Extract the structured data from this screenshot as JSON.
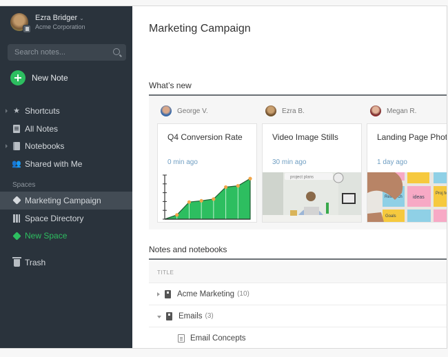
{
  "account": {
    "name": "Ezra Bridger",
    "org": "Acme Corporation",
    "chevron": "⌄"
  },
  "search": {
    "placeholder": "Search notes..."
  },
  "new_note": {
    "label": "New Note"
  },
  "nav": {
    "items": [
      {
        "label": "Shortcuts",
        "icon": "star-icon",
        "expandable": true
      },
      {
        "label": "All Notes",
        "icon": "notes-icon",
        "expandable": false
      },
      {
        "label": "Notebooks",
        "icon": "notebook-icon",
        "expandable": true
      },
      {
        "label": "Shared with Me",
        "icon": "people-icon",
        "expandable": false
      }
    ],
    "spaces_label": "Spaces",
    "spaces": [
      {
        "label": "Marketing Campaign",
        "icon": "cube-icon",
        "selected": true
      },
      {
        "label": "Space Directory",
        "icon": "building-icon",
        "selected": false
      },
      {
        "label": "New Space",
        "icon": "new-space-icon",
        "accent": "#2dbe60"
      }
    ],
    "trash": {
      "label": "Trash",
      "icon": "trash-icon"
    }
  },
  "main": {
    "title": "Marketing Campaign",
    "whats_new": {
      "title": "What’s new",
      "cards": [
        {
          "author": "George V.",
          "title": "Q4 Conversion Rate",
          "time": "0 min ago",
          "thumb": "chart"
        },
        {
          "author": "Ezra B.",
          "title": "Video Image Stills",
          "time": "30 min ago",
          "thumb": "photo",
          "thumb_search_text": "project plans"
        },
        {
          "author": "Megan R.",
          "title": "Landing Page Photos",
          "time": "1 day ago",
          "thumb": "sticky-notes",
          "sticky_labels": [
            "Research",
            "ideas",
            "Goals",
            "Proj Man"
          ]
        }
      ],
      "chart_thumb": {
        "type": "area",
        "values": [
          0,
          1,
          4,
          4.3,
          4.7,
          7.5,
          7.8,
          9.5
        ],
        "color": "#2dbe60",
        "point_color": "#f0a54a"
      }
    },
    "notes": {
      "title": "Notes and notebooks",
      "column_header": "TITLE",
      "rows": [
        {
          "type": "notebook",
          "label": "Acme Marketing",
          "count": "(10)",
          "expanded": false
        },
        {
          "type": "notebook",
          "label": "Emails",
          "count": "(3)",
          "expanded": true
        },
        {
          "type": "note",
          "label": "Email Concepts"
        }
      ]
    }
  },
  "colors": {
    "sidebar_bg": "#2a333c",
    "accent_green": "#2dbe60",
    "time_blue": "#6f9ec2"
  }
}
